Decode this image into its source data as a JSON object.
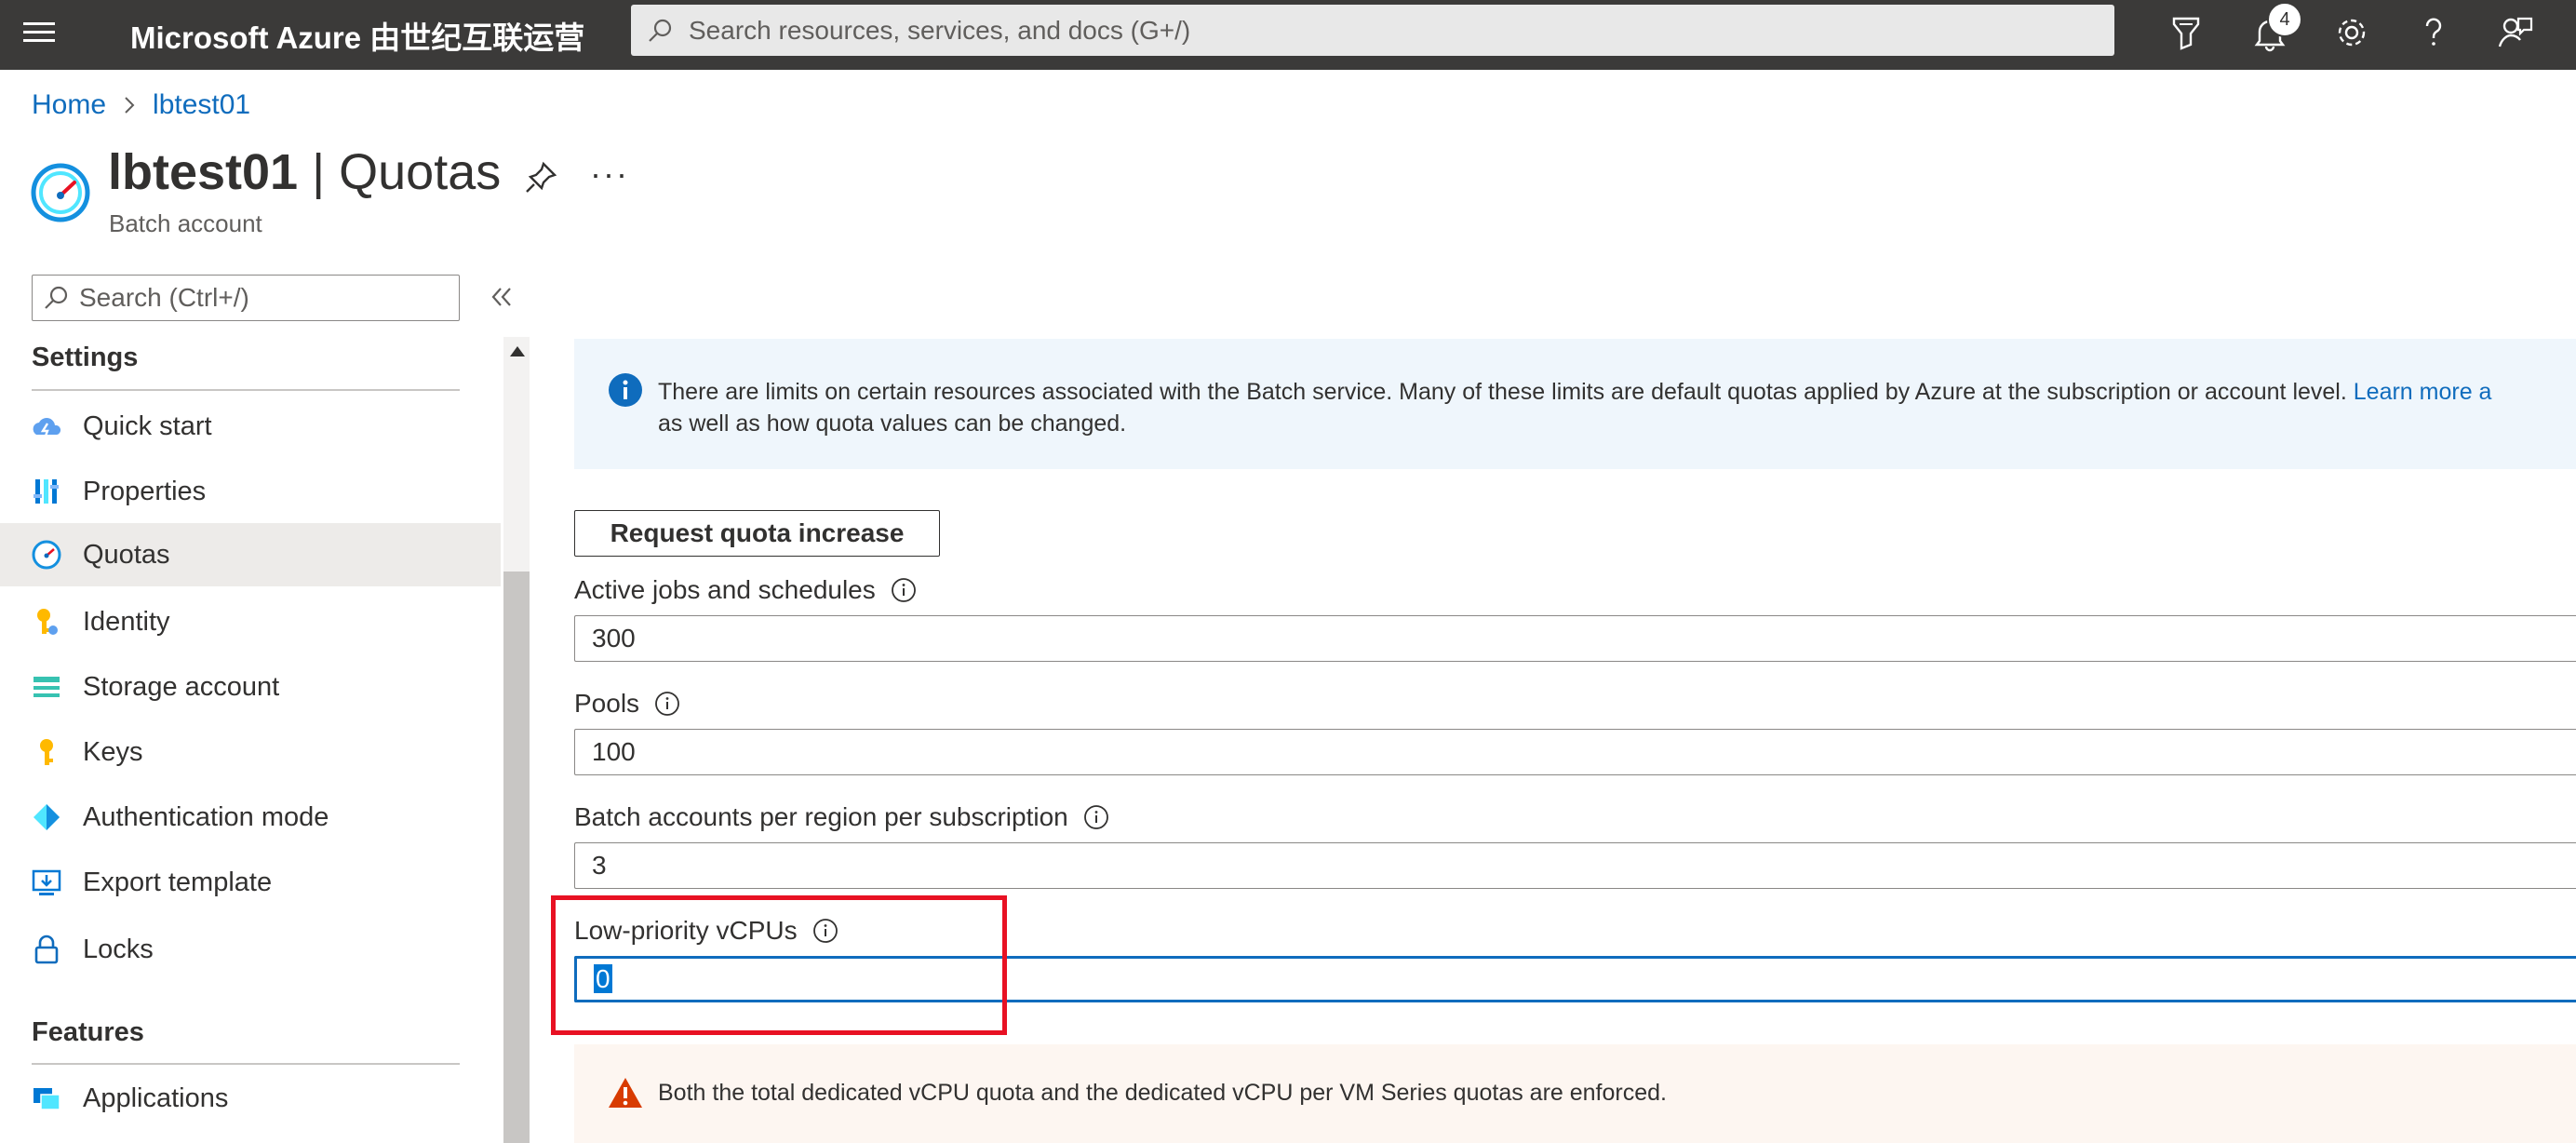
{
  "topbar": {
    "brand": "Microsoft Azure 由世纪互联运营",
    "search_placeholder": "Search resources, services, and docs (G+/)",
    "notification_count": "4"
  },
  "breadcrumb": {
    "home": "Home",
    "resource": "lbtest01"
  },
  "header": {
    "resource_name": "lbtest01",
    "separator": " | ",
    "page_name": "Quotas",
    "subtitle": "Batch account",
    "more": "···"
  },
  "nav": {
    "search_placeholder": "Search (Ctrl+/)",
    "sections": [
      {
        "label": "Settings"
      },
      {
        "label": "Features"
      }
    ],
    "items": [
      {
        "label": "Quick start",
        "icon": "cloud-lightning-icon"
      },
      {
        "label": "Properties",
        "icon": "properties-icon"
      },
      {
        "label": "Quotas",
        "icon": "quota-gauge-icon",
        "selected": true
      },
      {
        "label": "Identity",
        "icon": "key-identity-icon"
      },
      {
        "label": "Storage account",
        "icon": "storage-icon"
      },
      {
        "label": "Keys",
        "icon": "key-icon"
      },
      {
        "label": "Authentication mode",
        "icon": "diamond-icon"
      },
      {
        "label": "Export template",
        "icon": "export-template-icon"
      },
      {
        "label": "Locks",
        "icon": "lock-icon"
      },
      {
        "label": "Applications",
        "icon": "applications-icon"
      }
    ]
  },
  "main": {
    "info_text": "There are limits on certain resources associated with the Batch service. Many of these limits are default quotas applied by Azure at the subscription or account level.",
    "info_link": "Learn more a",
    "info_text2": "as well as how quota values can be changed.",
    "request_button": "Request quota increase",
    "fields": [
      {
        "label": "Active jobs and schedules",
        "value": "300"
      },
      {
        "label": "Pools",
        "value": "100"
      },
      {
        "label": "Batch accounts per region per subscription",
        "value": "3"
      },
      {
        "label": "Low-priority vCPUs",
        "value": "0"
      }
    ],
    "warning_text": "Both the total dedicated vCPU quota and the dedicated vCPU per VM Series quotas are enforced."
  },
  "colors": {
    "accent": "#0f6cbd",
    "highlight": "#e81123",
    "topbar": "#3b3a39"
  }
}
